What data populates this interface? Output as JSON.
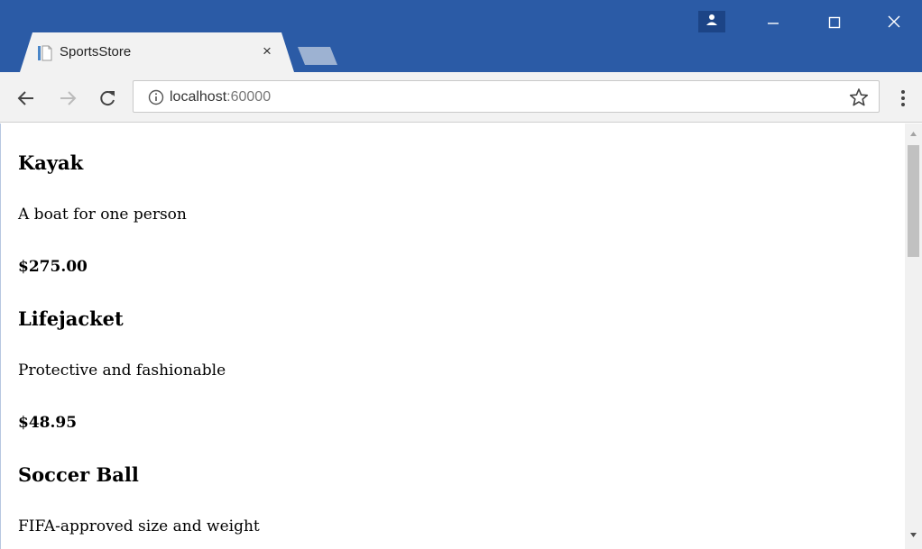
{
  "browser": {
    "tab": {
      "title": "SportsStore",
      "close_glyph": "×",
      "favicon": "page-icon"
    },
    "address": {
      "host": "localhost",
      "port": ":60000"
    }
  },
  "products": [
    {
      "name": "Kayak",
      "description": "A boat for one person",
      "price": "$275.00"
    },
    {
      "name": "Lifejacket",
      "description": "Protective and fashionable",
      "price": "$48.95"
    },
    {
      "name": "Soccer Ball",
      "description": "FIFA-approved size and weight",
      "price": ""
    }
  ],
  "colors": {
    "titlebar": "#2b5ba6",
    "toolbar": "#f2f2f2",
    "profile_button": "#1c4486"
  }
}
